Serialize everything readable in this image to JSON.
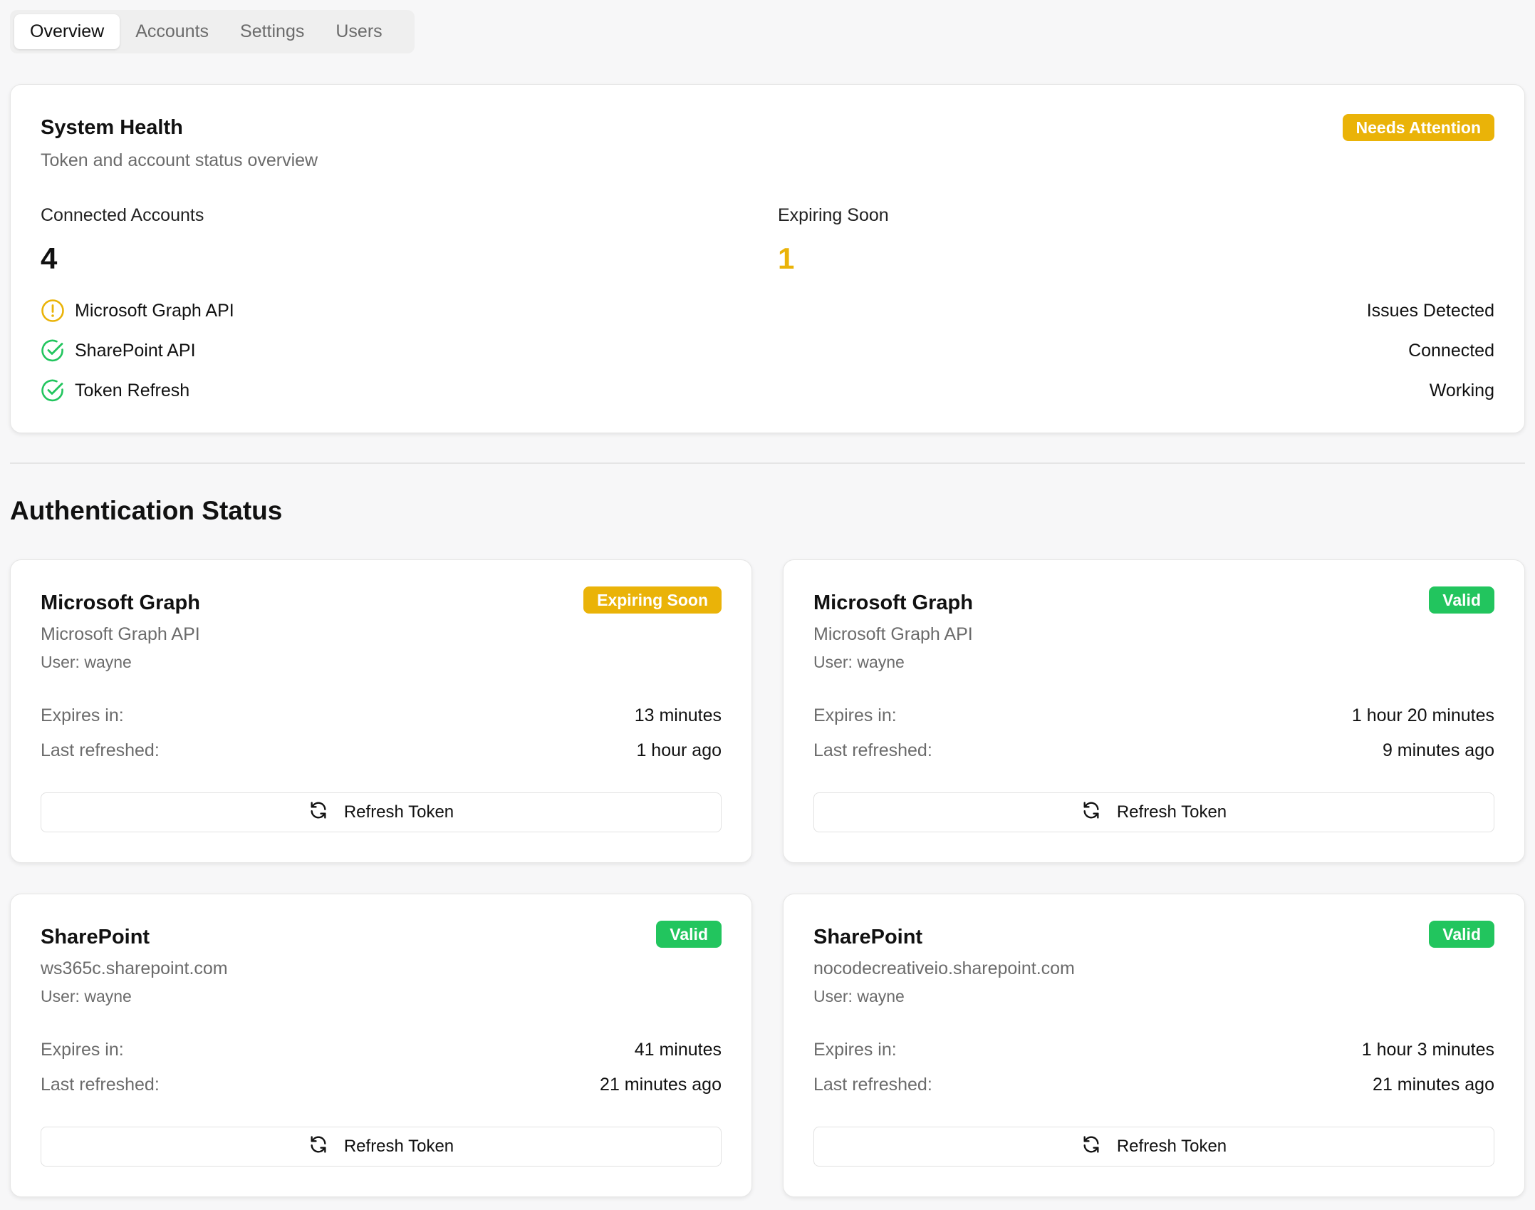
{
  "tabs": [
    {
      "label": "Overview",
      "active": true
    },
    {
      "label": "Accounts",
      "active": false
    },
    {
      "label": "Settings",
      "active": false
    },
    {
      "label": "Users",
      "active": false
    }
  ],
  "health": {
    "title": "System Health",
    "subtitle": "Token and account status overview",
    "badge": "Needs Attention",
    "connected_label": "Connected Accounts",
    "connected_value": "4",
    "expiring_label": "Expiring Soon",
    "expiring_value": "1",
    "services": [
      {
        "name": "Microsoft Graph API",
        "status": "Issues Detected",
        "icon": "warning-circle-icon"
      },
      {
        "name": "SharePoint API",
        "status": "Connected",
        "icon": "check-circle-icon"
      },
      {
        "name": "Token Refresh",
        "status": "Working",
        "icon": "check-circle-icon"
      }
    ]
  },
  "auth": {
    "section_title": "Authentication Status",
    "expires_label": "Expires in:",
    "refreshed_label": "Last refreshed:",
    "refresh_button": "Refresh Token",
    "cards": [
      {
        "title": "Microsoft Graph",
        "subtitle": "Microsoft Graph API",
        "user": "User: wayne",
        "badge": "Expiring Soon",
        "status": "warn",
        "expires": "13 minutes",
        "refreshed": "1 hour ago"
      },
      {
        "title": "Microsoft Graph",
        "subtitle": "Microsoft Graph API",
        "user": "User: wayne",
        "badge": "Valid",
        "status": "ok",
        "expires": "1 hour 20 minutes",
        "refreshed": "9 minutes ago"
      },
      {
        "title": "SharePoint",
        "subtitle": "ws365c.sharepoint.com",
        "user": "User: wayne",
        "badge": "Valid",
        "status": "ok",
        "expires": "41 minutes",
        "refreshed": "21 minutes ago"
      },
      {
        "title": "SharePoint",
        "subtitle": "nocodecreativeio.sharepoint.com",
        "user": "User: wayne",
        "badge": "Valid",
        "status": "ok",
        "expires": "1 hour 3 minutes",
        "refreshed": "21 minutes ago"
      }
    ]
  },
  "colors": {
    "warning": "#eab308",
    "success": "#22c55e"
  }
}
